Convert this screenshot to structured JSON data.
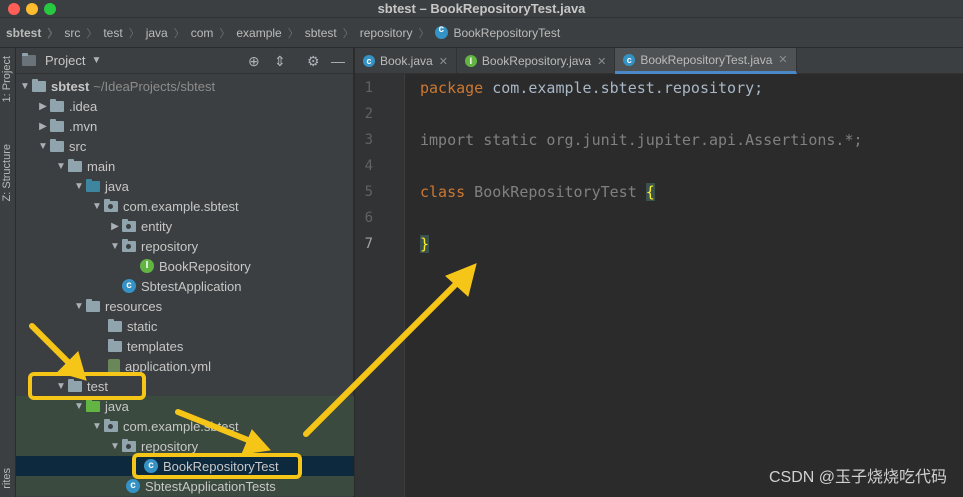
{
  "window": {
    "title": "sbtest – BookRepositoryTest.java"
  },
  "breadcrumb": [
    "sbtest",
    "src",
    "test",
    "java",
    "com",
    "example",
    "sbtest",
    "repository",
    "BookRepositoryTest"
  ],
  "left_strip": {
    "project_tab": "1: Project",
    "structure_tab": "Z: Structure",
    "favorites_tab": "rites"
  },
  "project_panel": {
    "title": "Project",
    "tree": [
      {
        "label": "sbtest",
        "path": "~/IdeaProjects/sbtest"
      },
      {
        "label": ".idea"
      },
      {
        "label": ".mvn"
      },
      {
        "label": "src"
      },
      {
        "label": "main"
      },
      {
        "label": "java"
      },
      {
        "label": "com.example.sbtest"
      },
      {
        "label": "entity"
      },
      {
        "label": "repository"
      },
      {
        "label": "BookRepository"
      },
      {
        "label": "SbtestApplication"
      },
      {
        "label": "resources"
      },
      {
        "label": "static"
      },
      {
        "label": "templates"
      },
      {
        "label": "application.yml"
      },
      {
        "label": "test"
      },
      {
        "label": "java"
      },
      {
        "label": "com.example.sbtest"
      },
      {
        "label": "repository"
      },
      {
        "label": "BookRepositoryTest"
      },
      {
        "label": "SbtestApplicationTests"
      }
    ]
  },
  "editor": {
    "tabs": [
      {
        "label": "Book.java",
        "icon": "class-icon"
      },
      {
        "label": "BookRepository.java",
        "icon": "interface-icon"
      },
      {
        "label": "BookRepositoryTest.java",
        "icon": "class-icon",
        "active": true
      }
    ],
    "lines": [
      "1",
      "2",
      "3",
      "4",
      "5",
      "6",
      "7"
    ],
    "code": {
      "line1_kw": "package",
      "line1_rest": " com.example.sbtest.repository;",
      "line3": "import static org.junit.jupiter.api.Assertions.*;",
      "line5_kw": "class",
      "line5_name": " BookRepositoryTest ",
      "line5_brace": "{",
      "line7_brace": "}"
    }
  },
  "watermark": "CSDN @玉子烧烧吃代码",
  "colors": {
    "annotation": "#f5c518",
    "keyword": "#cc7832",
    "selection": "#0d293e"
  }
}
